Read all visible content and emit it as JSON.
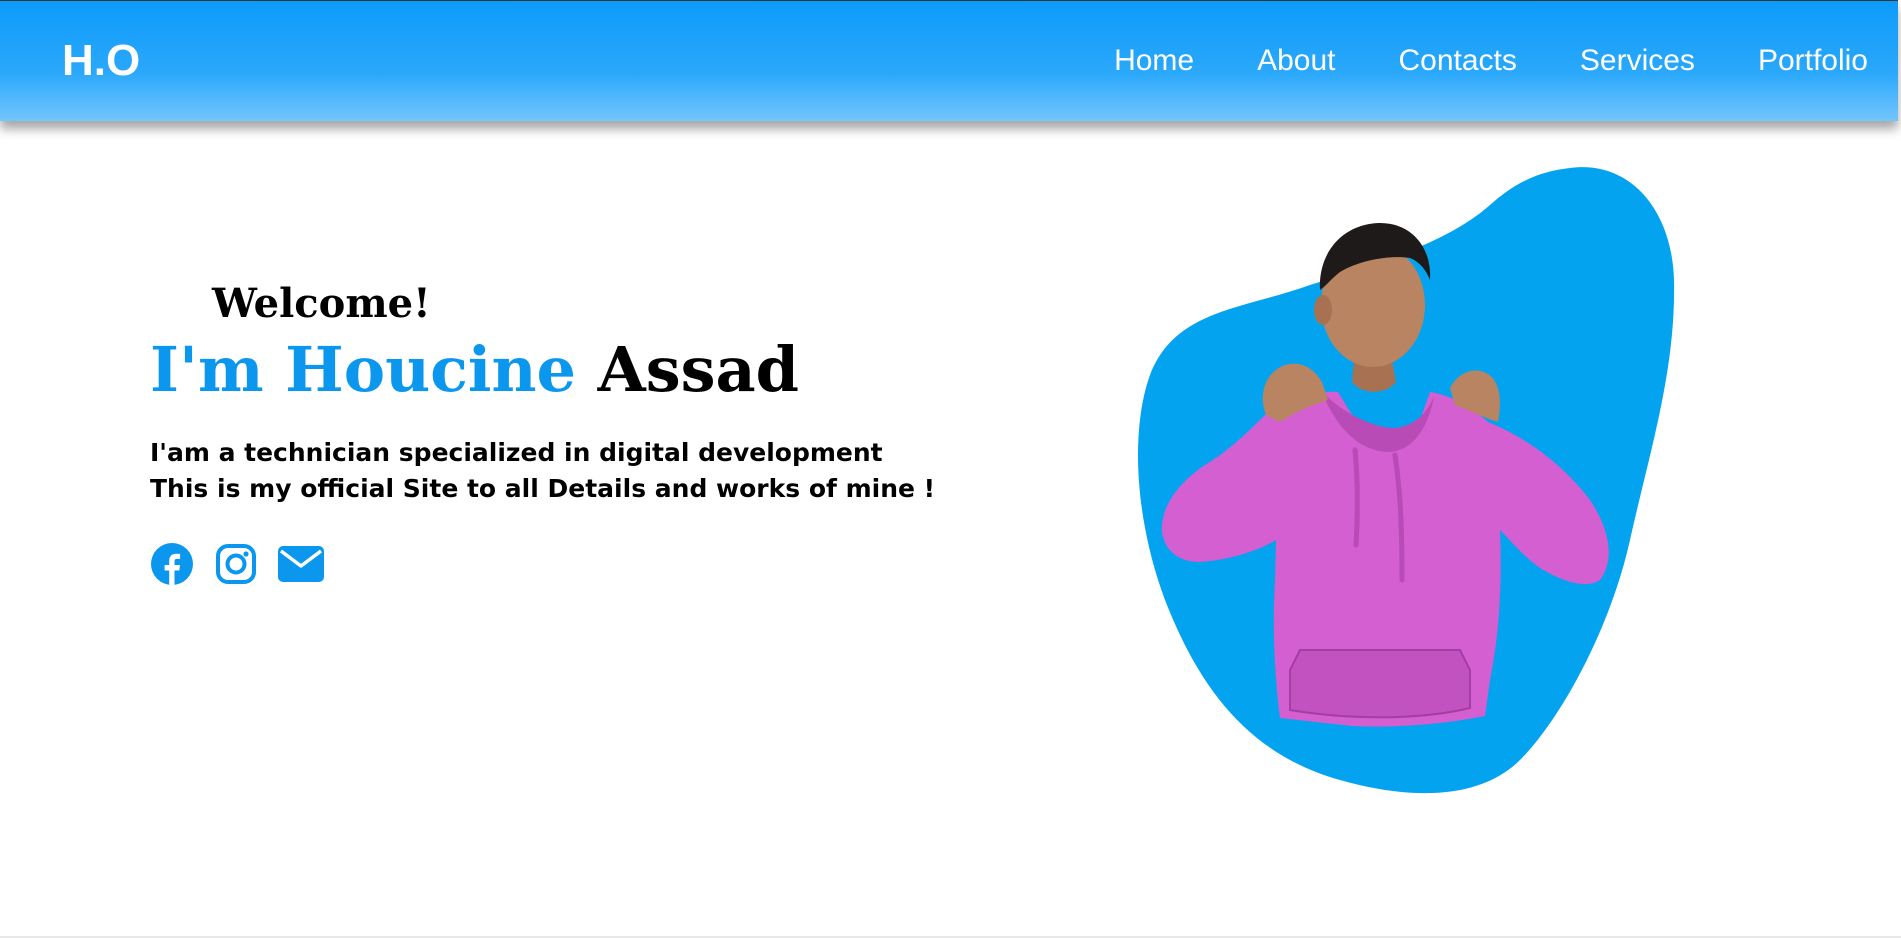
{
  "navbar": {
    "logo": "H.O",
    "links": [
      {
        "label": "Home"
      },
      {
        "label": "About"
      },
      {
        "label": "Contacts"
      },
      {
        "label": "Services"
      },
      {
        "label": "Portfolio"
      }
    ]
  },
  "hero": {
    "welcome": "Welcome!",
    "name_prefix": "I'm Houcine ",
    "name_last": "Assad",
    "description_line1": "I'am a technician specialized in digital development",
    "description_line2": "This is my official Site to all Details and works of mine !",
    "socials": [
      {
        "icon": "facebook-icon"
      },
      {
        "icon": "instagram-icon"
      },
      {
        "icon": "envelope-icon"
      }
    ]
  },
  "colors": {
    "accent": "#0c97ee",
    "blob": "#04a3ef",
    "hoodie": "#d35fd0",
    "nav_gradient_top": "#0d9bfb",
    "nav_gradient_bottom": "#74c5fd"
  }
}
